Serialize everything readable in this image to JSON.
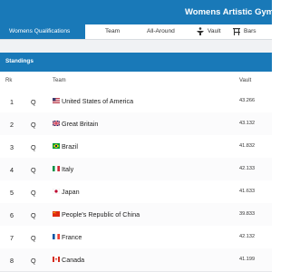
{
  "header": {
    "title": "Womens Artistic Gymnastics"
  },
  "tabs": [
    {
      "label": "Womens Qualifications",
      "icon": "none"
    },
    {
      "label": "Team",
      "icon": "none"
    },
    {
      "label": "All-Around",
      "icon": "none"
    },
    {
      "label": "Vault",
      "icon": "vault-icon"
    },
    {
      "label": "Bars",
      "icon": "bars-icon"
    }
  ],
  "standings": {
    "title": "Standings",
    "columns": {
      "rank": "Rk",
      "team": "Team",
      "score": "Vault"
    },
    "rows": [
      {
        "rank": "1",
        "status": "Q",
        "team": "United States of America",
        "score": "43.266",
        "flag": "usa-flag-icon"
      },
      {
        "rank": "2",
        "status": "Q",
        "team": "Great Britain",
        "score": "43.132",
        "flag": "great-britain-flag-icon"
      },
      {
        "rank": "3",
        "status": "Q",
        "team": "Brazil",
        "score": "41.832",
        "flag": "brazil-flag-icon"
      },
      {
        "rank": "4",
        "status": "Q",
        "team": "Italy",
        "score": "42.133",
        "flag": "italy-flag-icon"
      },
      {
        "rank": "5",
        "status": "Q",
        "team": "Japan",
        "score": "41.633",
        "flag": "japan-flag-icon"
      },
      {
        "rank": "6",
        "status": "Q",
        "team": "People's Republic of China",
        "score": "39.833",
        "flag": "china-flag-icon"
      },
      {
        "rank": "7",
        "status": "Q",
        "team": "France",
        "score": "42.132",
        "flag": "france-flag-icon"
      },
      {
        "rank": "8",
        "status": "Q",
        "team": "Canada",
        "score": "41.199",
        "flag": "canada-flag-icon"
      }
    ]
  },
  "colors": {
    "brand": "#1979b8",
    "gap": "#f0f2f4"
  }
}
